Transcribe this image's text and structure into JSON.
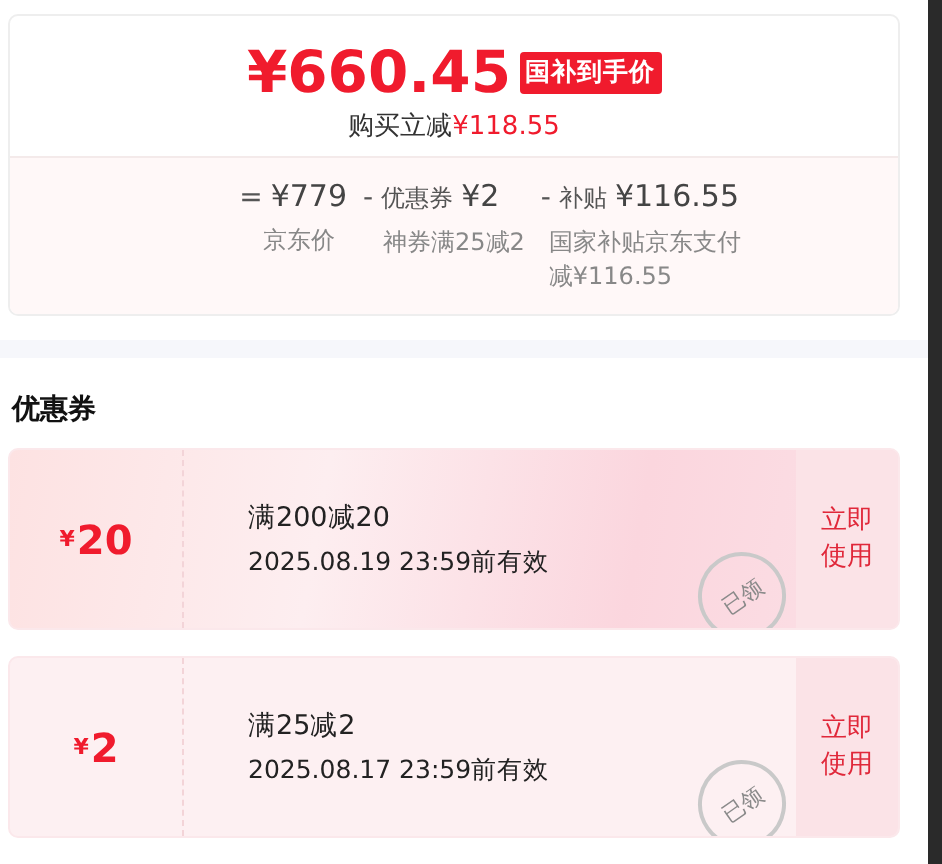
{
  "price_card": {
    "price": "¥660.45",
    "badge": "国补到手价",
    "savings_label": "购买立减",
    "savings_amount": "¥118.55",
    "breakdown": [
      {
        "operator": "=",
        "amount": "¥779",
        "note": "京东价"
      },
      {
        "operator": "-",
        "label": "优惠券",
        "amount": "¥2",
        "note": "神券满25减2"
      },
      {
        "operator": "-",
        "label": "补贴",
        "amount": "¥116.55",
        "note": "国家补贴京东支付减¥116.55"
      }
    ]
  },
  "coupons_section": {
    "title": "优惠券",
    "coupons": [
      {
        "currency": "¥",
        "amount": "20",
        "condition": "满200减20",
        "validity": "2025.08.19 23:59前有效",
        "stamp": "已领",
        "highlighted": true,
        "action": "立即使用"
      },
      {
        "currency": "¥",
        "amount": "2",
        "condition": "满25减2",
        "validity": "2025.08.17 23:59前有效",
        "stamp": "已领",
        "highlighted": false,
        "action": "立即使用"
      }
    ]
  }
}
